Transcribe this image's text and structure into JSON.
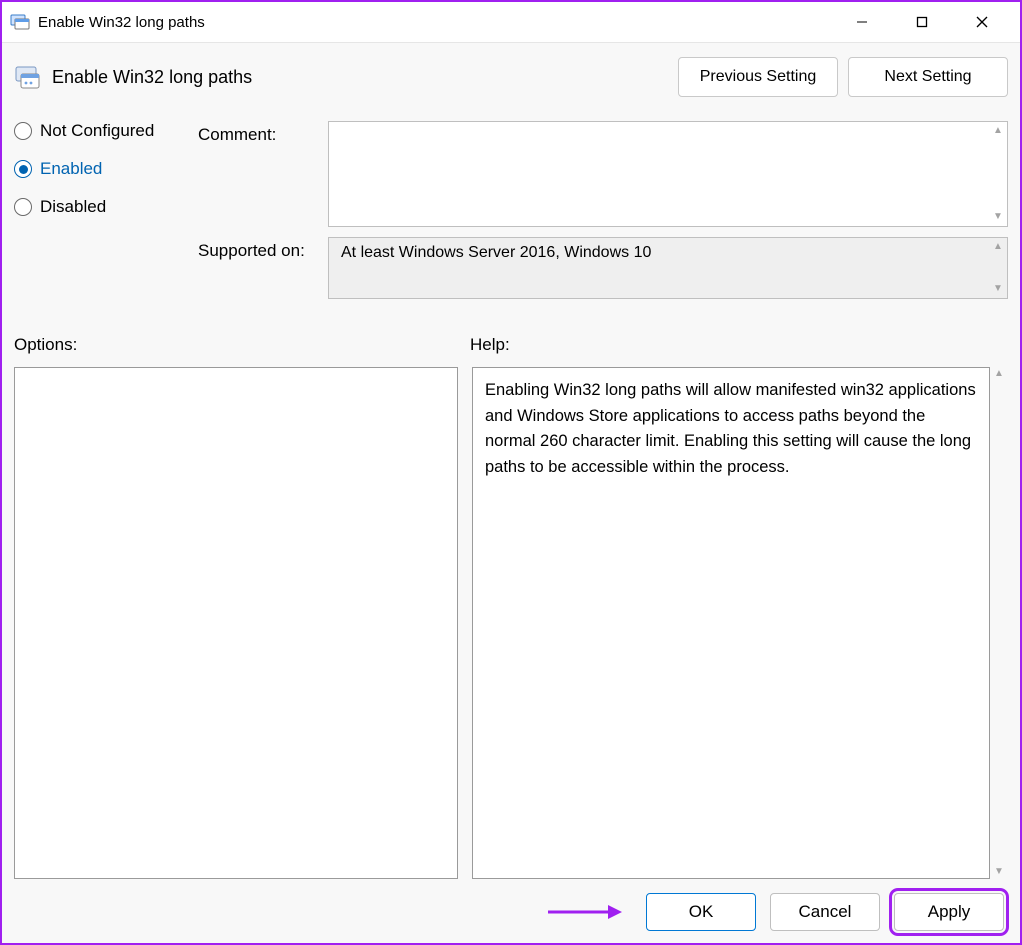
{
  "titlebar": {
    "title": "Enable Win32 long paths"
  },
  "header": {
    "policy_title": "Enable Win32 long paths",
    "previous_setting_label": "Previous Setting",
    "next_setting_label": "Next Setting"
  },
  "state_options": {
    "not_configured_label": "Not Configured",
    "enabled_label": "Enabled",
    "disabled_label": "Disabled",
    "selected": "Enabled"
  },
  "fields": {
    "comment_label": "Comment:",
    "comment_value": "",
    "supported_label": "Supported on:",
    "supported_value": "At least Windows Server 2016, Windows 10"
  },
  "lower": {
    "options_label": "Options:",
    "help_label": "Help:",
    "help_text": "Enabling Win32 long paths will allow manifested win32 applications and Windows Store applications to access paths beyond the normal 260 character limit.  Enabling this setting will cause the long paths to be accessible within the process."
  },
  "buttons": {
    "ok_label": "OK",
    "cancel_label": "Cancel",
    "apply_label": "Apply"
  }
}
